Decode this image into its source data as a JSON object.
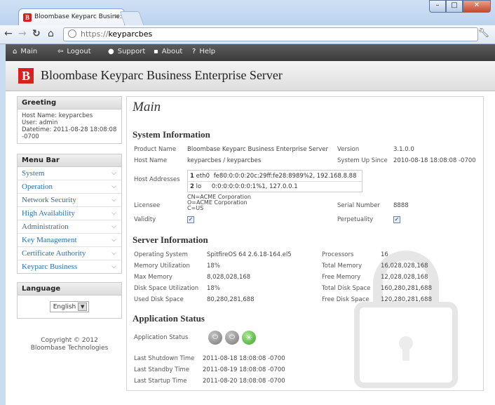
{
  "browser": {
    "tab_title": "Bloombase Keyparc Busine:",
    "tab_close": "×",
    "url_scheme": "https://",
    "url_host": "keyparcbes",
    "window_min": "–",
    "window_max": "□",
    "window_close": "✕"
  },
  "appnav": {
    "items": [
      {
        "label": "Main",
        "icon": "home-icon"
      },
      {
        "label": "Logout",
        "icon": "logout-icon"
      },
      {
        "label": "Support",
        "icon": "support-icon"
      },
      {
        "label": "About",
        "icon": "about-icon"
      },
      {
        "label": "Help",
        "icon": "help-icon"
      }
    ]
  },
  "banner": {
    "logo_letter": "B",
    "title": "Bloombase Keyparc Business Enterprise Server"
  },
  "sidebar": {
    "greeting": {
      "heading": "Greeting",
      "host": "Host Name: keyparcbes",
      "user": "User: admin",
      "datetime": "Datetime: 2011-08-28 18:08:08 -0700"
    },
    "menu": {
      "heading": "Menu Bar",
      "items": [
        {
          "label": "System"
        },
        {
          "label": "Operation"
        },
        {
          "label": "Network Security"
        },
        {
          "label": "High Availability"
        },
        {
          "label": "Administration"
        },
        {
          "label": "Key Management"
        },
        {
          "label": "Certificate Authority"
        },
        {
          "label": "Keyparc Business"
        }
      ]
    },
    "language": {
      "heading": "Language",
      "selected": "English"
    },
    "copyright_line1": "Copyright © 2012",
    "copyright_line2": "Bloombase Technologies"
  },
  "main": {
    "title": "Main",
    "system_info": {
      "heading": "System Information",
      "product_name_label": "Product Name",
      "product_name": "Bloombase Keyparc Business Enterprise Server",
      "version_label": "Version",
      "version": "3.1.0.0",
      "host_name_label": "Host Name",
      "host_name": "keyparcbes / keyparcbes",
      "system_up_since_label": "System Up Since",
      "system_up_since": "2010-08-18 18:08:08 -0700",
      "host_addresses_label": "Host Addresses",
      "addresses": [
        {
          "idx": "1",
          "iface": "eth0",
          "addr": "fe80:0:0:0:20c:29ff:fe28:8989%2, 192.168.8.88"
        },
        {
          "idx": "2",
          "iface": "lo",
          "addr": "0:0:0:0:0:0:0:1%1, 127.0.0.1"
        }
      ],
      "licensee_label": "Licensee",
      "licensee_cn": "CN=ACME Corporation",
      "licensee_o": "O=ACME Corporation",
      "licensee_c": "C=US",
      "serial_number_label": "Serial Number",
      "serial_number": "8888",
      "validity_label": "Validity",
      "perpetuality_label": "Perpetuality",
      "check_mark": "✓"
    },
    "server_info": {
      "heading": "Server Information",
      "os_label": "Operating System",
      "os": "SpitfireOS 64 2.6.18-164.el5",
      "processors_label": "Processors",
      "processors": "16",
      "mem_util_label": "Memory Utilization",
      "mem_util": "18%",
      "total_mem_label": "Total Memory",
      "total_mem": "16,028,028,168",
      "max_mem_label": "Max Memory",
      "max_mem": "8,028,028,168",
      "free_mem_label": "Free Memory",
      "free_mem": "12,028,028,168",
      "disk_util_label": "Disk Space Utilization",
      "disk_util": "18%",
      "total_disk_label": "Total Disk Space",
      "total_disk": "160,280,281,688",
      "used_disk_label": "Used Disk Space",
      "used_disk": "80,280,281,688",
      "free_disk_label": "Free Disk Space",
      "free_disk": "120,280,281,688"
    },
    "app_status": {
      "heading": "Application Status",
      "status_label": "Application Status",
      "last_shutdown_label": "Last Shutdown Time",
      "last_shutdown": "2011-08-18 18:08:08 -0700",
      "last_standby_label": "Last Standby Time",
      "last_standby": "2011-08-19 18:08:08 -0700",
      "last_startup_label": "Last Startup Time",
      "last_startup": "2011-08-20 18:08:08 -0700"
    }
  },
  "colors": {
    "brand_red": "#d8201f",
    "menu_link": "#2b6ea8",
    "status_running": "#5cc24a",
    "status_idle": "#8c8c8c"
  }
}
